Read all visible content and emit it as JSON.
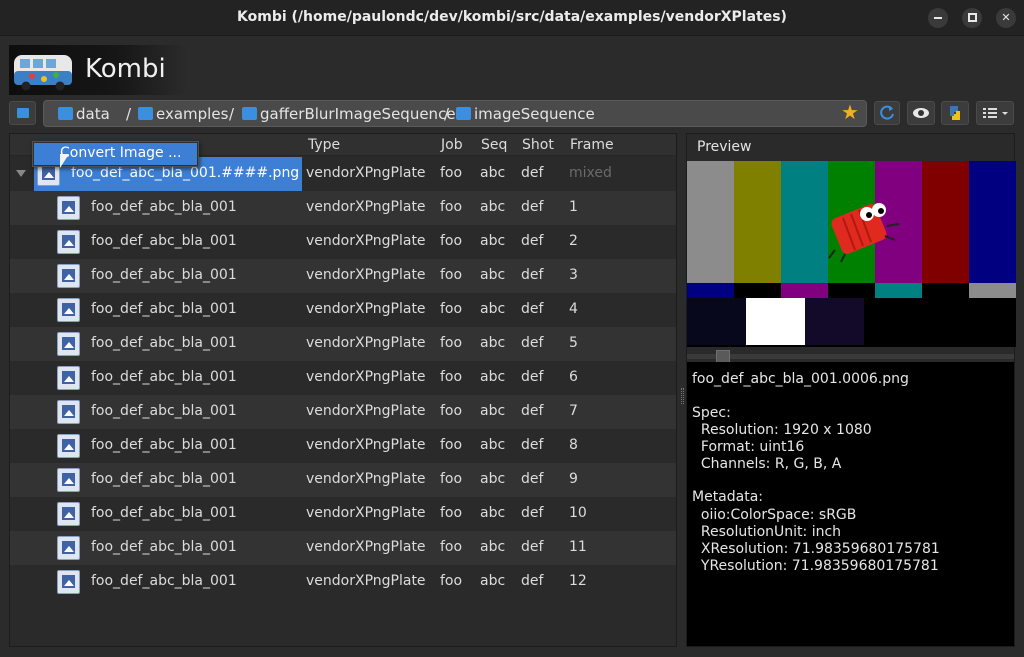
{
  "window": {
    "title": "Kombi (/home/paulondc/dev/kombi/src/data/examples/vendorXPlates)"
  },
  "app": {
    "logo_text": "Kombi"
  },
  "breadcrumbs": [
    {
      "label": "data"
    },
    {
      "label": "examples"
    },
    {
      "label": "gafferBlurImageSequence"
    },
    {
      "label": "imageSequence"
    }
  ],
  "breadcrumb_separator": "/",
  "favorite_icon": "star-icon",
  "toolbar_icons": [
    "refresh-icon",
    "eye-icon",
    "python-icon",
    "list-view-icon"
  ],
  "columns": [
    "Type",
    "Job",
    "Seq",
    "Shot",
    "Frame"
  ],
  "context_menu": {
    "item": "Convert Image ..."
  },
  "sequence_row": {
    "name": "foo_def_abc_bla_001.####.png",
    "type": "vendorXPngPlate",
    "job": "foo",
    "seq": "abc",
    "shot": "def",
    "frame": "mixed"
  },
  "rows": [
    {
      "name": "foo_def_abc_bla_001",
      "type": "vendorXPngPlate",
      "job": "foo",
      "seq": "abc",
      "shot": "def",
      "frame": "1"
    },
    {
      "name": "foo_def_abc_bla_001",
      "type": "vendorXPngPlate",
      "job": "foo",
      "seq": "abc",
      "shot": "def",
      "frame": "2"
    },
    {
      "name": "foo_def_abc_bla_001",
      "type": "vendorXPngPlate",
      "job": "foo",
      "seq": "abc",
      "shot": "def",
      "frame": "3"
    },
    {
      "name": "foo_def_abc_bla_001",
      "type": "vendorXPngPlate",
      "job": "foo",
      "seq": "abc",
      "shot": "def",
      "frame": "4"
    },
    {
      "name": "foo_def_abc_bla_001",
      "type": "vendorXPngPlate",
      "job": "foo",
      "seq": "abc",
      "shot": "def",
      "frame": "5"
    },
    {
      "name": "foo_def_abc_bla_001",
      "type": "vendorXPngPlate",
      "job": "foo",
      "seq": "abc",
      "shot": "def",
      "frame": "6"
    },
    {
      "name": "foo_def_abc_bla_001",
      "type": "vendorXPngPlate",
      "job": "foo",
      "seq": "abc",
      "shot": "def",
      "frame": "7"
    },
    {
      "name": "foo_def_abc_bla_001",
      "type": "vendorXPngPlate",
      "job": "foo",
      "seq": "abc",
      "shot": "def",
      "frame": "8"
    },
    {
      "name": "foo_def_abc_bla_001",
      "type": "vendorXPngPlate",
      "job": "foo",
      "seq": "abc",
      "shot": "def",
      "frame": "9"
    },
    {
      "name": "foo_def_abc_bla_001",
      "type": "vendorXPngPlate",
      "job": "foo",
      "seq": "abc",
      "shot": "def",
      "frame": "10"
    },
    {
      "name": "foo_def_abc_bla_001",
      "type": "vendorXPngPlate",
      "job": "foo",
      "seq": "abc",
      "shot": "def",
      "frame": "11"
    },
    {
      "name": "foo_def_abc_bla_001",
      "type": "vendorXPngPlate",
      "job": "foo",
      "seq": "abc",
      "shot": "def",
      "frame": "12"
    }
  ],
  "preview": {
    "label": "Preview",
    "file_name": "foo_def_abc_bla_001.0006.png",
    "spec_header": "Spec:",
    "resolution": "  Resolution: 1920 x 1080",
    "format": "  Format: uint16",
    "channels": "  Channels: R, G, B, A",
    "metadata_header": "Metadata:",
    "color_space": "  oiio:ColorSpace: sRGB",
    "resolution_unit": "  ResolutionUnit: inch",
    "x_resolution": "  XResolution: 71.98359680175781",
    "y_resolution": "  YResolution: 71.98359680175781"
  },
  "colors": {
    "selection": "#3c7fd4",
    "folder": "#3a8fe0",
    "star": "#f0b020",
    "color_bars": [
      "#8c8c8c",
      "#808000",
      "#008080",
      "#008000",
      "#800080",
      "#800000",
      "#000080"
    ]
  }
}
